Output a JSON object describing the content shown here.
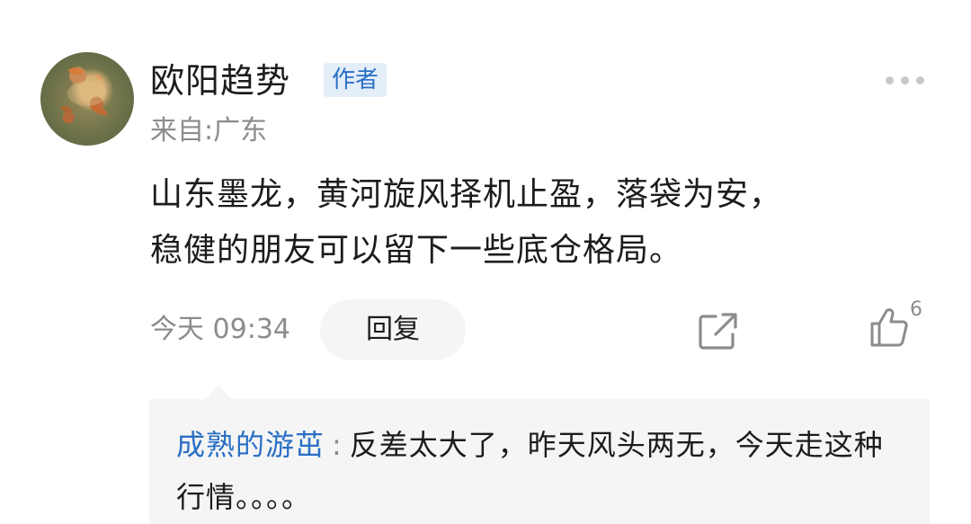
{
  "comment": {
    "username": "欧阳趋势",
    "author_badge": "作者",
    "location": "来自:广东",
    "text_line1": "山东墨龙，黄河旋风择机止盈，落袋为安，",
    "text_line2": "稳健的朋友可以留下一些底仓格局。",
    "time": "今天 09:34",
    "reply_label": "回复",
    "like_count": "6",
    "icons": {
      "more": "more-dots-icon",
      "share": "share-icon",
      "like": "thumbs-up-icon"
    }
  },
  "sub_reply": {
    "username": "成熟的游茁",
    "separator": ":",
    "text": "反差太大了，昨天风头两无，今天走这种行情。。。。"
  },
  "colors": {
    "link_blue": "#2a6fc4",
    "badge_bg": "#e4eef9",
    "muted_gray": "#8c8c8c",
    "sub_bg": "#f5f5f5"
  }
}
